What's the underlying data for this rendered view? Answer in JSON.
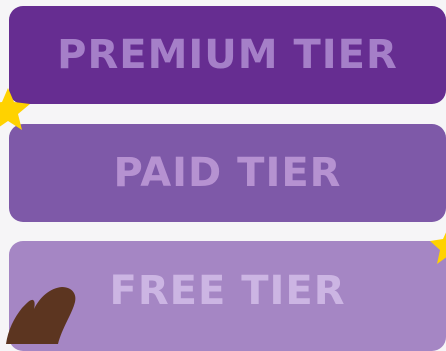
{
  "tiers": [
    {
      "label": "PREMIUM TIER",
      "bg": "#662d91",
      "text_color": "#a57fc8"
    },
    {
      "label": "PAID TIER",
      "bg": "#7e59a8",
      "text_color": "#b692d1"
    },
    {
      "label": "FREE TIER",
      "bg": "#a586c4",
      "text_color": "#ccb5e3"
    }
  ],
  "decorations": {
    "star_color": "#ffd200",
    "hand_color": "#5c3520",
    "star_icon": "star-icon",
    "hand_icon": "pointing-hand-icon"
  }
}
